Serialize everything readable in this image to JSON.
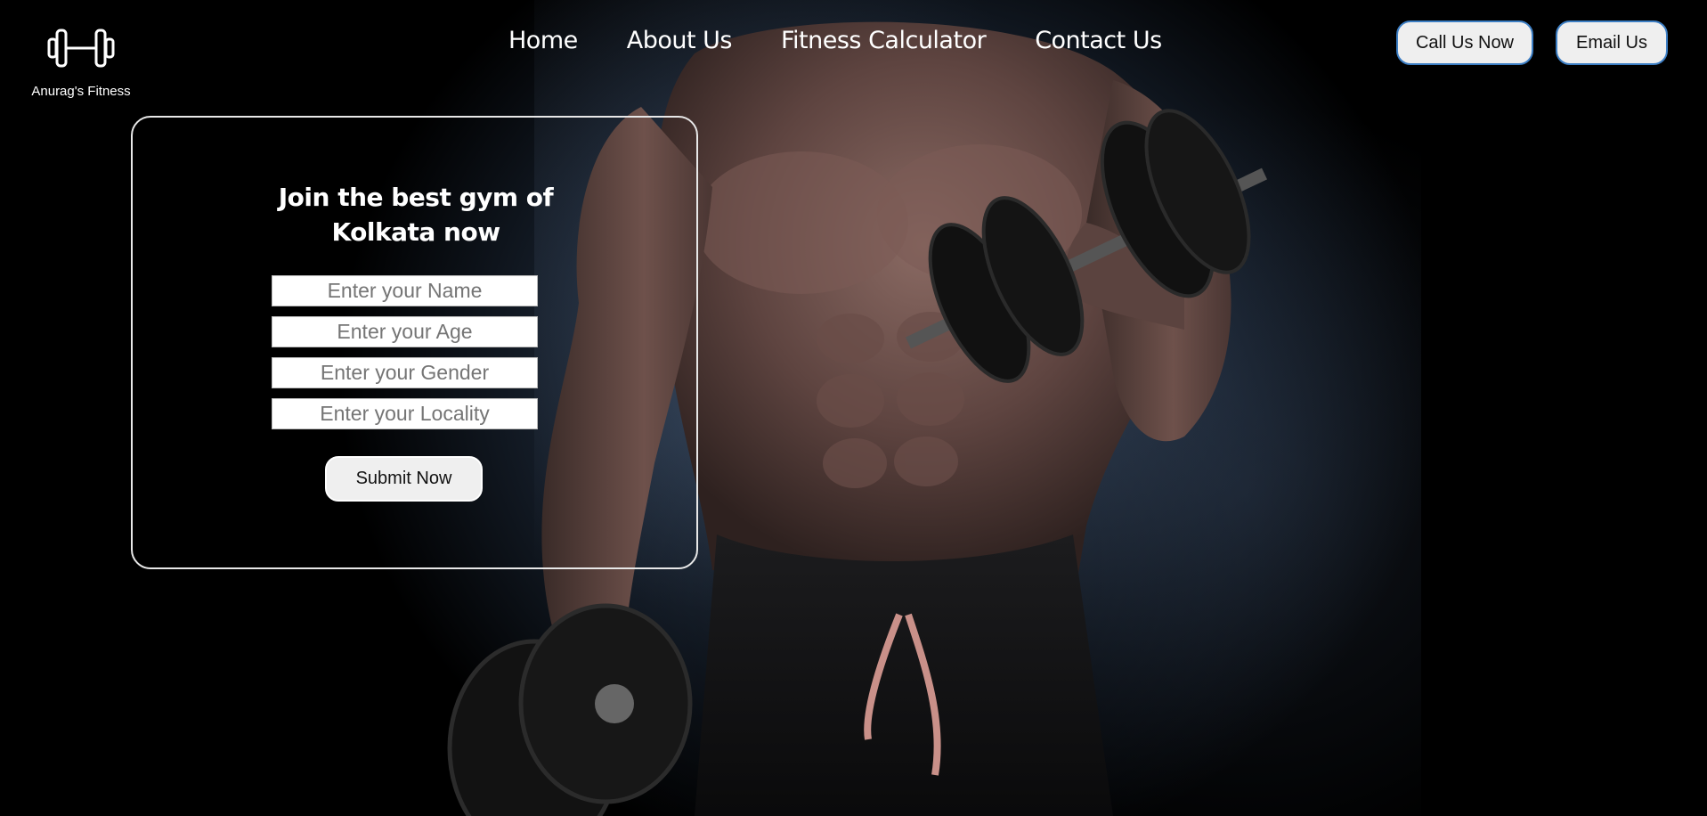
{
  "brand": {
    "name": "Anurag's Fitness",
    "logo_icon": "dumbbell-icon"
  },
  "nav": {
    "items": [
      {
        "label": "Home"
      },
      {
        "label": "About Us"
      },
      {
        "label": "Fitness Calculator"
      },
      {
        "label": "Contact Us"
      }
    ]
  },
  "header_buttons": {
    "call_label": "Call Us Now",
    "email_label": "Email Us"
  },
  "join_form": {
    "title_line1": "Join the best gym of",
    "title_line2": "Kolkata now",
    "name_placeholder": "Enter your Name",
    "age_placeholder": "Enter your Age",
    "gender_placeholder": "Enter your Gender",
    "locality_placeholder": "Enter your Locality",
    "submit_label": "Submit Now"
  },
  "hero_image": {
    "subject": "muscular-athlete-with-dumbbells"
  },
  "colors": {
    "background": "#000000",
    "button_border": "#3c7ec4",
    "button_fill": "#efefef",
    "text": "#ffffff"
  }
}
